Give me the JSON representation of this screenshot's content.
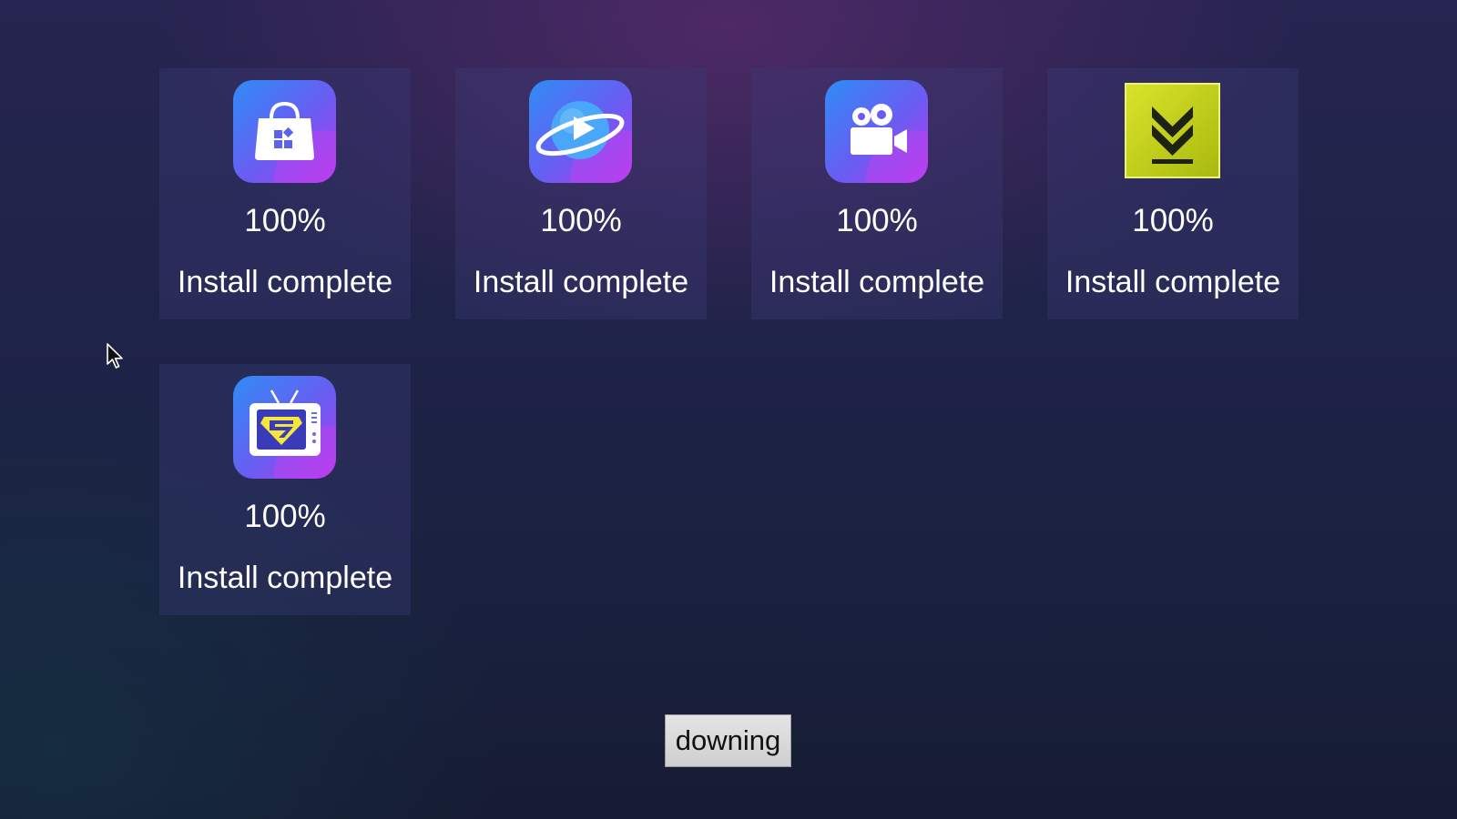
{
  "colors": {
    "tile_bg": "#2e2d62",
    "text": "#ffffff",
    "icon_gradient_start": "#3a8bf5",
    "icon_gradient_end": "#b33cf0",
    "download_icon_bg": "#c3d21a",
    "button_bg": "#d8d8d8"
  },
  "apps": [
    {
      "icon": "app-store-bag-icon",
      "percent": "100%",
      "status": "Install complete"
    },
    {
      "icon": "video-planet-play-icon",
      "percent": "100%",
      "status": "Install complete"
    },
    {
      "icon": "video-camera-icon",
      "percent": "100%",
      "status": "Install complete"
    },
    {
      "icon": "download-arrow-icon",
      "percent": "100%",
      "status": "Install complete"
    },
    {
      "icon": "tv-s-logo-icon",
      "percent": "100%",
      "status": "Install complete"
    }
  ],
  "button": {
    "label": "downing"
  }
}
